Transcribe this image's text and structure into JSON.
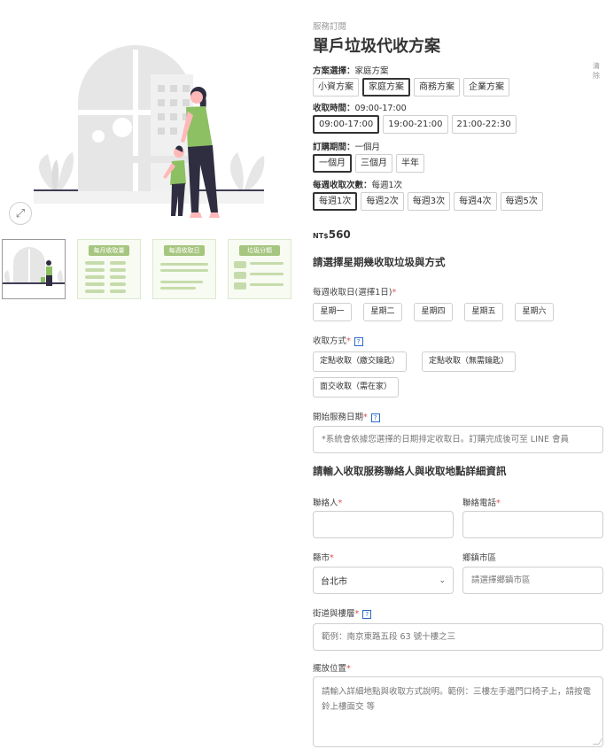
{
  "gallery": {
    "zoom_icon": "expand-arrows-icon",
    "thumbs": [
      {
        "title": ""
      },
      {
        "title": "每月收取量"
      },
      {
        "title": "每週收取日"
      },
      {
        "title": "垃圾分類"
      }
    ]
  },
  "product": {
    "breadcrumb": "服務訂閱",
    "title": "單戶垃圾代收方案",
    "clear_label": "清除",
    "price_currency": "NT$",
    "price_value": "560"
  },
  "attributes": {
    "plan": {
      "label": "方案選擇：",
      "value": "家庭方案",
      "options": [
        "小資方案",
        "家庭方案",
        "商務方案",
        "企業方案"
      ],
      "selected_index": 1
    },
    "time": {
      "label": "收取時間：",
      "value": "09:00-17:00",
      "options": [
        "09:00-17:00",
        "19:00-21:00",
        "21:00-22:30"
      ],
      "selected_index": 0
    },
    "period": {
      "label": "訂購期間：",
      "value": "一個月",
      "options": [
        "一個月",
        "三個月",
        "半年"
      ],
      "selected_index": 0
    },
    "frequency": {
      "label": "每週收取次數：",
      "value": "每週1次",
      "options": [
        "每週1次",
        "每週2次",
        "每週3次",
        "每週4次",
        "每週5次"
      ],
      "selected_index": 0
    }
  },
  "schedule": {
    "section_title": "請選擇星期幾收取垃圾與方式",
    "days_label": "每週收取日(選擇1日)",
    "days": [
      "星期一",
      "星期二",
      "星期四",
      "星期五",
      "星期六"
    ],
    "method_label": "收取方式",
    "methods": [
      "定點收取（繳交鑰匙）",
      "定點收取（無需鑰匙）",
      "面交收取（需在家）"
    ],
    "start_label": "開始服務日期",
    "start_placeholder": "*系統會依據您選擇的日期排定收取日。訂購完成後可至 LINE 會員"
  },
  "contact": {
    "section_title": "請輸入收取服務聯絡人與收取地點詳細資訊",
    "name_label": "聯絡人",
    "phone_label": "聯絡電話",
    "county_label": "縣市",
    "county_value": "台北市",
    "district_label": "鄉鎮市區",
    "district_placeholder": "請選擇鄉鎮市區",
    "street_label": "街道與樓層",
    "street_placeholder": "範例：南京東路五段 63 號十樓之三",
    "location_label": "擺放位置",
    "location_placeholder": "請輸入詳細地點與收取方式說明。範例：三樓左手邊門口椅子上，請按電鈴上樓面交 等"
  },
  "colors": {
    "accent_green": "#8cc063",
    "figure_dark": "#2f2e41",
    "illustration_gray": "#e6e6e6",
    "required_red": "#d9534f",
    "help_blue": "#2a6ac9"
  }
}
